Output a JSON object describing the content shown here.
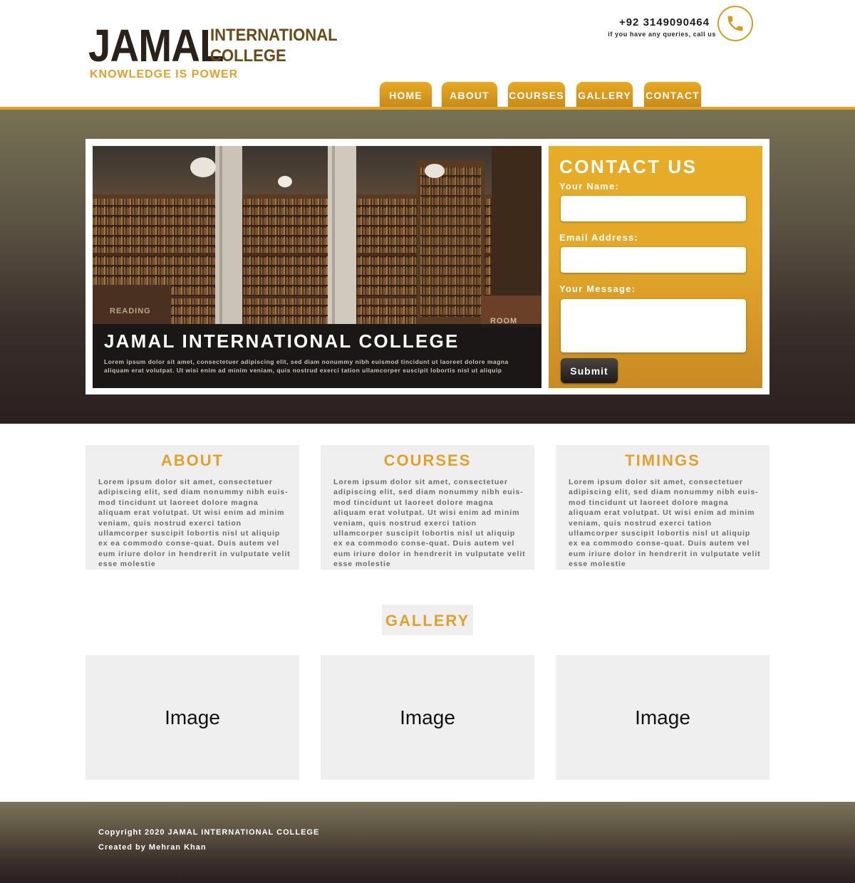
{
  "header": {
    "logo_main": "JAMAL",
    "logo_sub_line1": "INTERNATIONAL",
    "logo_sub_line2": "COLLEGE",
    "tagline": "KNOWLEDGE IS POWER",
    "phone_number": "+92 3149090464",
    "phone_note": "if you have any queries, call us",
    "phone_icon": "phone-icon"
  },
  "nav": {
    "items": [
      {
        "label": "HOME"
      },
      {
        "label": "ABOUT"
      },
      {
        "label": "COURSES"
      },
      {
        "label": "GALLERY"
      },
      {
        "label": "CONTACT"
      }
    ]
  },
  "hero": {
    "title": "JAMAL INTERNATIONAL COLLEGE",
    "text": "Lorem ipsum dolor sit amet, consectetuer adipiscing elit, sed diam nonummy nibh euismod tincidunt ut laoreet dolore magna aliquam erat volutpat. Ut wisi enim ad minim veniam, quis nostrud exerci tation ullamcorper suscipit lobortis nisl ut aliquip",
    "image_signs": {
      "left": "READING",
      "right": "ROOM"
    }
  },
  "contact": {
    "title": "CONTACT US",
    "name_label": "Your Name:",
    "email_label": "Email Address:",
    "message_label": "Your Message:",
    "name_value": "",
    "email_value": "",
    "message_value": "",
    "submit_label": "Submit"
  },
  "cards": [
    {
      "title": "ABOUT",
      "text": "Lorem ipsum dolor sit amet, consectetuer adipiscing elit, sed diam nonummy nibh euis-mod tincidunt ut laoreet dolore magna aliquam erat volutpat. Ut wisi enim ad minim veniam, quis nostrud exerci tation ullamcorper suscipit lobortis nisl ut aliquip ex ea commodo conse-quat. Duis autem vel eum iriure dolor in hendrerit in vulputate velit esse molestie"
    },
    {
      "title": "COURSES",
      "text": "Lorem ipsum dolor sit amet, consectetuer adipiscing elit, sed diam nonummy nibh euis-mod tincidunt ut laoreet dolore magna aliquam erat volutpat. Ut wisi enim ad minim veniam, quis nostrud exerci tation ullamcorper suscipit lobortis nisl ut aliquip ex ea commodo conse-quat. Duis autem vel eum iriure dolor in hendrerit in vulputate velit esse molestie"
    },
    {
      "title": "TIMINGS",
      "text": "Lorem ipsum dolor sit amet, consectetuer adipiscing elit, sed diam nonummy nibh euis-mod tincidunt ut laoreet dolore magna aliquam erat volutpat. Ut wisi enim ad minim veniam, quis nostrud exerci tation ullamcorper suscipit lobortis nisl ut aliquip ex ea commodo conse-quat. Duis autem vel eum iriure dolor in hendrerit in vulputate velit esse molestie"
    }
  ],
  "gallery": {
    "title": "GALLERY",
    "items": [
      {
        "label": "Image"
      },
      {
        "label": "Image"
      },
      {
        "label": "Image"
      }
    ]
  },
  "footer": {
    "copyright": "Copyright 2020 JAMAL INTERNATIONAL COLLEGE",
    "credit": "Created by Mehran Khan"
  },
  "colors": {
    "accent_gold": "#e2a12c",
    "dark_brown": "#2a211a",
    "card_bg": "#efefef"
  }
}
